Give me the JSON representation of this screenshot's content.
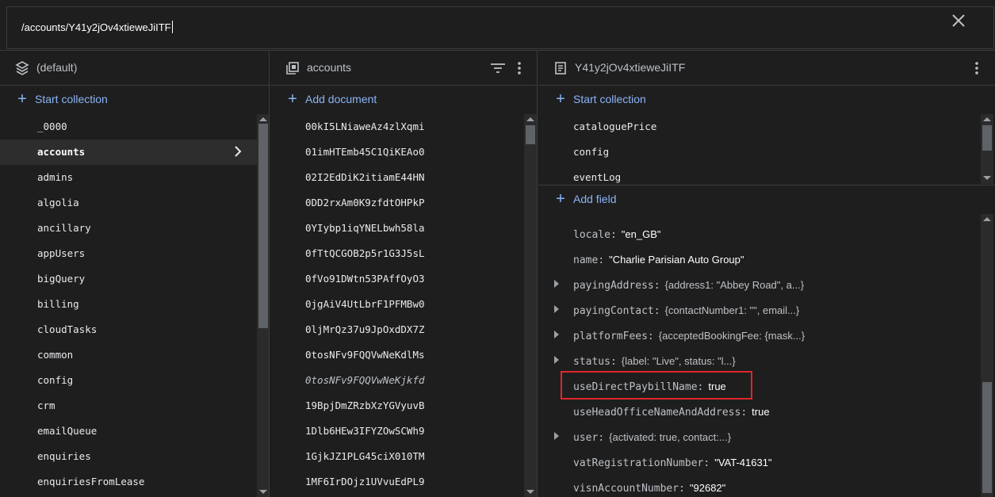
{
  "path": {
    "value": "/accounts/Y41y2jOv4xtieweJiITF"
  },
  "panels": {
    "root": {
      "title": "(default)",
      "action": "Start collection",
      "items": [
        "_0000",
        "accounts",
        "admins",
        "algolia",
        "ancillary",
        "appUsers",
        "bigQuery",
        "billing",
        "cloudTasks",
        "common",
        "config",
        "crm",
        "emailQueue",
        "enquiries",
        "enquiriesFromLease"
      ]
    },
    "collection": {
      "title": "accounts",
      "action": "Add document",
      "items": [
        "00kI5LNiaweAz4zlXqmi",
        "01imHTEmb45C1QiKEAo0",
        "02I2EdDiK2itiamE44HN",
        "0DD2rxAm0K9zfdtOHPkP",
        "0YIybp1iqYNELbwh58la",
        "0fTtQCGOB2p5r1G3J5sL",
        "0fVo91DWtn53PAffOyO3",
        "0jgAiV4UtLbrF1PFMBw0",
        "0ljMrQz37u9JpOxdDX7Z",
        "0tosNFv9FQQVwNeKdlMs",
        "0tosNFv9FQQVwNeKjkfd",
        "19BpjDmZRzbXzYGVyuvB",
        "1Dlb6HEw3IFYZOwSCWh9",
        "1GjkJZ1PLG45ciX010TM",
        "1MF6IrDOjz1UVvuEdPL9"
      ]
    },
    "document": {
      "title": "Y41y2jOv4xtieweJiITF",
      "collection_action": "Start collection",
      "subcollections": [
        "cataloguePrice",
        "config",
        "eventLog"
      ],
      "field_action": "Add field",
      "fields": [
        {
          "key": "locale",
          "value": "\"en_GB\"",
          "expandable": false
        },
        {
          "key": "name",
          "value": "\"Charlie Parisian Auto Group\"",
          "expandable": false
        },
        {
          "key": "payingAddress",
          "value": "{address1: \"Abbey Road\", a...}",
          "expandable": true
        },
        {
          "key": "payingContact",
          "value": "{contactNumber1: \"\", email...}",
          "expandable": true
        },
        {
          "key": "platformFees",
          "value": "{acceptedBookingFee: {mask...}",
          "expandable": true
        },
        {
          "key": "status",
          "value": "{label: \"Live\", status: \"l...}",
          "expandable": true
        },
        {
          "key": "useDirectPaybillName",
          "value": "true",
          "expandable": false
        },
        {
          "key": "useHeadOfficeNameAndAddress",
          "value": "true",
          "expandable": false
        },
        {
          "key": "user",
          "value": "{activated: true, contact:...}",
          "expandable": true
        },
        {
          "key": "vatRegistrationNumber",
          "value": "\"VAT-41631\"",
          "expandable": false
        },
        {
          "key": "visnAccountNumber",
          "value": "\"92682\"",
          "expandable": false
        }
      ]
    }
  },
  "colors": {
    "accent": "#8ab4f8",
    "background": "#1e1e1e",
    "highlight": "#e0262c"
  },
  "icons": {
    "close": "close-icon",
    "root": "firestore-icon",
    "collection": "collection-icon",
    "document": "document-icon",
    "filter": "filter-icon",
    "menu": "more-vert-icon",
    "add": "plus-icon",
    "chevron": "chevron-right-icon",
    "expand": "expand-arrow-icon"
  }
}
